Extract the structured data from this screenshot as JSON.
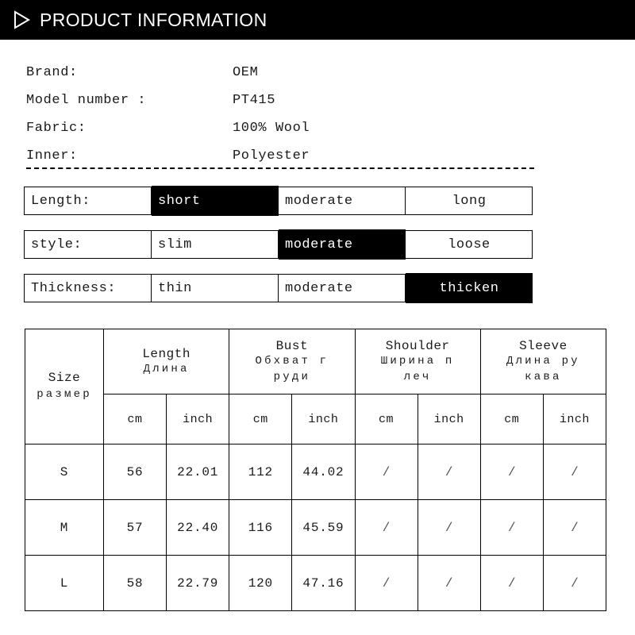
{
  "header": {
    "title": "PRODUCT INFORMATION",
    "icon": "play-triangle-icon",
    "background": "#000000",
    "text_color": "#ffffff"
  },
  "specs": [
    {
      "label": "Brand:",
      "value": "OEM"
    },
    {
      "label": "Model number :",
      "value": "PT415"
    },
    {
      "label": "Fabric:",
      "value": "100% Wool"
    },
    {
      "label": "Inner:",
      "value": "Polyester"
    }
  ],
  "options": [
    {
      "label": "Length:",
      "choices": [
        {
          "text": "short",
          "selected": true,
          "align": "left"
        },
        {
          "text": "moderate",
          "selected": false,
          "align": "left"
        },
        {
          "text": "long",
          "selected": false,
          "align": "center"
        }
      ]
    },
    {
      "label": "style:",
      "choices": [
        {
          "text": "slim",
          "selected": false,
          "align": "left"
        },
        {
          "text": "moderate",
          "selected": true,
          "align": "left"
        },
        {
          "text": "loose",
          "selected": false,
          "align": "center"
        }
      ]
    },
    {
      "label": "Thickness:",
      "choices": [
        {
          "text": "thin",
          "selected": false,
          "align": "left"
        },
        {
          "text": "moderate",
          "selected": false,
          "align": "left"
        },
        {
          "text": "thicken",
          "selected": true,
          "align": "center"
        }
      ]
    }
  ],
  "size_table": {
    "size_header": {
      "en": "Size",
      "ru_line1": "размер",
      "ru_line2": ""
    },
    "groups": [
      {
        "en": "Length",
        "ru_line1": "Длина",
        "ru_line2": ""
      },
      {
        "en": "Bust",
        "ru_line1": "Обхват г",
        "ru_line2": "руди"
      },
      {
        "en": "Shoulder",
        "ru_line1": "Ширина п",
        "ru_line2": "леч"
      },
      {
        "en": "Sleeve",
        "ru_line1": "Длина ру",
        "ru_line2": "кава"
      }
    ],
    "units": [
      "cm",
      "inch",
      "cm",
      "inch",
      "cm",
      "inch",
      "cm",
      "inch"
    ],
    "rows": [
      {
        "size": "S",
        "values": [
          "56",
          "22.01",
          "112",
          "44.02",
          "/",
          "/",
          "/",
          "/"
        ]
      },
      {
        "size": "M",
        "values": [
          "57",
          "22.40",
          "116",
          "45.59",
          "/",
          "/",
          "/",
          "/"
        ]
      },
      {
        "size": "L",
        "values": [
          "58",
          "22.79",
          "120",
          "47.16",
          "/",
          "/",
          "/",
          "/"
        ]
      }
    ]
  }
}
